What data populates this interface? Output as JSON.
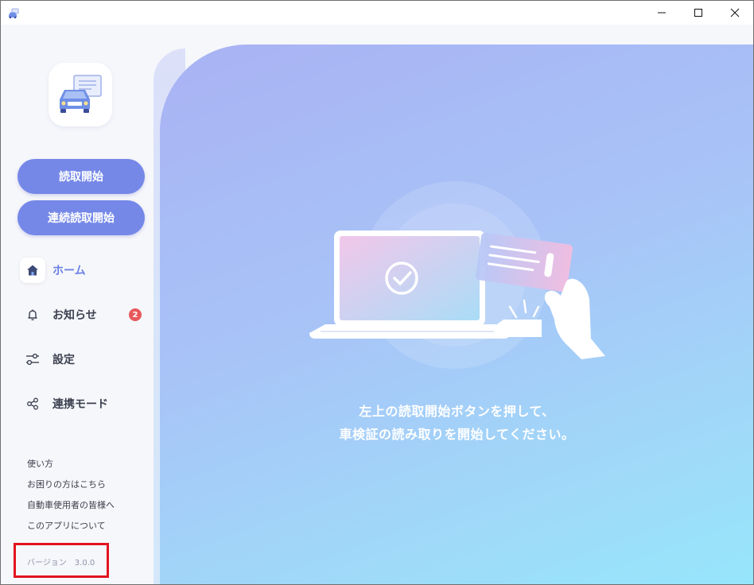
{
  "window": {
    "app_icon": "car-app-icon",
    "controls": [
      "minimize",
      "maximize",
      "close"
    ]
  },
  "sidebar": {
    "logo": "car-document-logo",
    "actions": {
      "start_read": "読取開始",
      "continuous_read": "連続読取開始"
    },
    "nav": [
      {
        "label": "ホーム",
        "icon": "home-icon",
        "active": true
      },
      {
        "label": "お知らせ",
        "icon": "bell-icon",
        "badge": "2"
      },
      {
        "label": "設定",
        "icon": "settings-sliders-icon"
      },
      {
        "label": "連携モード",
        "icon": "share-icon"
      }
    ],
    "footer_links": [
      "使い方",
      "お困りの方はこちら",
      "自動車使用者の皆様へ",
      "このアプリについて"
    ],
    "version": "バージョン　3.0.0"
  },
  "main": {
    "illustration": "laptop-card-reader-illustration",
    "message_line1": "左上の読取開始ボタンを押して、",
    "message_line2": "車検証の読み取りを開始してください。"
  },
  "colors": {
    "accent": "#7588e8",
    "active_nav": "#6b7fe4",
    "badge": "#e8585b",
    "highlight": "#e2131f"
  }
}
